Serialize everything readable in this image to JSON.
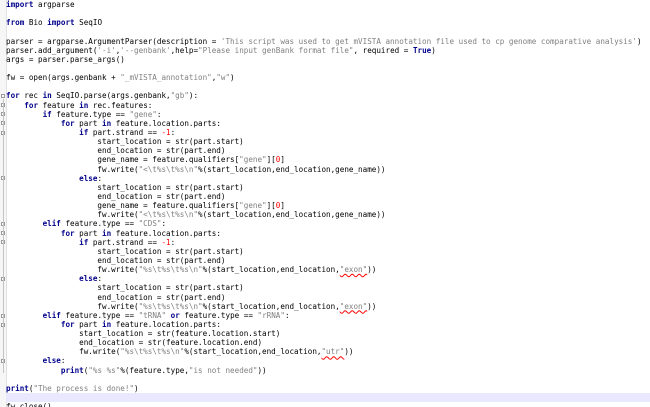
{
  "editor": {
    "language": "python",
    "current_line_index": 43,
    "colors": {
      "background": "#ffffff",
      "keyword": "#00008b",
      "string": "#808080",
      "number": "#ff0000",
      "current_line": "#e8e8ff",
      "gutter": "#f6f6f6"
    },
    "lines": [
      [
        {
          "t": "kw",
          "v": "import"
        },
        {
          "t": "",
          "v": " argparse"
        }
      ],
      [],
      [
        {
          "t": "kw",
          "v": "from"
        },
        {
          "t": "",
          "v": " Bio "
        },
        {
          "t": "kw",
          "v": "import"
        },
        {
          "t": "",
          "v": " SeqIO"
        }
      ],
      [],
      [
        {
          "t": "",
          "v": "parser = argparse.ArgumentParser(description = "
        },
        {
          "t": "str",
          "v": "'This script was used to get mVISTA annotation file used to cp genome comparative analysis'"
        },
        {
          "t": "",
          "v": ")"
        }
      ],
      [
        {
          "t": "",
          "v": "parser.add_argument("
        },
        {
          "t": "str",
          "v": "'-i'"
        },
        {
          "t": "",
          "v": ","
        },
        {
          "t": "str",
          "v": "'--genbank'"
        },
        {
          "t": "",
          "v": ",help="
        },
        {
          "t": "str",
          "v": "\"Please input genBank format file\""
        },
        {
          "t": "",
          "v": ", required = "
        },
        {
          "t": "kw",
          "v": "True"
        },
        {
          "t": "",
          "v": ")"
        }
      ],
      [
        {
          "t": "",
          "v": "args = parser.parse_args()"
        }
      ],
      [],
      [
        {
          "t": "",
          "v": "fw = open(args.genbank + "
        },
        {
          "t": "str",
          "v": "\"_mVISTA_annotation\""
        },
        {
          "t": "",
          "v": ","
        },
        {
          "t": "str",
          "v": "\"w\""
        },
        {
          "t": "",
          "v": ")"
        }
      ],
      [],
      [
        {
          "t": "kw",
          "v": "for"
        },
        {
          "t": "",
          "v": " rec "
        },
        {
          "t": "kw",
          "v": "in"
        },
        {
          "t": "",
          "v": " SeqIO.parse(args.genbank,"
        },
        {
          "t": "str",
          "v": "\"gb\""
        },
        {
          "t": "",
          "v": "):"
        }
      ],
      [
        {
          "t": "",
          "v": "    "
        },
        {
          "t": "kw",
          "v": "for"
        },
        {
          "t": "",
          "v": " feature "
        },
        {
          "t": "kw",
          "v": "in"
        },
        {
          "t": "",
          "v": " rec.features:"
        }
      ],
      [
        {
          "t": "",
          "v": "        "
        },
        {
          "t": "kw",
          "v": "if"
        },
        {
          "t": "",
          "v": " feature.type == "
        },
        {
          "t": "str",
          "v": "\"gene\""
        },
        {
          "t": "",
          "v": ":"
        }
      ],
      [
        {
          "t": "",
          "v": "            "
        },
        {
          "t": "kw",
          "v": "for"
        },
        {
          "t": "",
          "v": " part "
        },
        {
          "t": "kw",
          "v": "in"
        },
        {
          "t": "",
          "v": " feature.location.parts:"
        }
      ],
      [
        {
          "t": "",
          "v": "                "
        },
        {
          "t": "kw",
          "v": "if"
        },
        {
          "t": "",
          "v": " part.strand == "
        },
        {
          "t": "num",
          "v": "-1"
        },
        {
          "t": "",
          "v": ":"
        }
      ],
      [
        {
          "t": "",
          "v": "                    start_location = str(part.start)"
        }
      ],
      [
        {
          "t": "",
          "v": "                    end_location = str(part.end)"
        }
      ],
      [
        {
          "t": "",
          "v": "                    gene_name = feature.qualifiers["
        },
        {
          "t": "str",
          "v": "\"gene\""
        },
        {
          "t": "",
          "v": "]["
        },
        {
          "t": "num",
          "v": "0"
        },
        {
          "t": "",
          "v": "]"
        }
      ],
      [
        {
          "t": "",
          "v": "                    fw.write("
        },
        {
          "t": "str",
          "v": "\"<\\t%s\\t%s\\n\""
        },
        {
          "t": "",
          "v": "%(start_location,end_location,gene_name))"
        }
      ],
      [
        {
          "t": "",
          "v": "                "
        },
        {
          "t": "kw",
          "v": "else"
        },
        {
          "t": "",
          "v": ":"
        }
      ],
      [
        {
          "t": "",
          "v": "                    start_location = str(part.start)"
        }
      ],
      [
        {
          "t": "",
          "v": "                    end_location = str(part.end)"
        }
      ],
      [
        {
          "t": "",
          "v": "                    gene_name = feature.qualifiers["
        },
        {
          "t": "str",
          "v": "\"gene\""
        },
        {
          "t": "",
          "v": "]["
        },
        {
          "t": "num",
          "v": "0"
        },
        {
          "t": "",
          "v": "]"
        }
      ],
      [
        {
          "t": "",
          "v": "                    fw.write("
        },
        {
          "t": "str",
          "v": "\"<\\t%s\\t%s\\n\""
        },
        {
          "t": "",
          "v": "%(start_location,end_location,gene_name))"
        }
      ],
      [
        {
          "t": "",
          "v": "        "
        },
        {
          "t": "kw",
          "v": "elif"
        },
        {
          "t": "",
          "v": " feature.type == "
        },
        {
          "t": "str",
          "v": "\"CDS\""
        },
        {
          "t": "",
          "v": ":"
        }
      ],
      [
        {
          "t": "",
          "v": "            "
        },
        {
          "t": "kw",
          "v": "for"
        },
        {
          "t": "",
          "v": " part "
        },
        {
          "t": "kw",
          "v": "in"
        },
        {
          "t": "",
          "v": " feature.location.parts:"
        }
      ],
      [
        {
          "t": "",
          "v": "                "
        },
        {
          "t": "kw",
          "v": "if"
        },
        {
          "t": "",
          "v": " part.strand == "
        },
        {
          "t": "num",
          "v": "-1"
        },
        {
          "t": "",
          "v": ":"
        }
      ],
      [
        {
          "t": "",
          "v": "                    start_location = str(part.start)"
        }
      ],
      [
        {
          "t": "",
          "v": "                    end_location = str(part.end)"
        }
      ],
      [
        {
          "t": "",
          "v": "                    fw.write("
        },
        {
          "t": "str",
          "v": "\"%s\\t%s\\t%s\\n\""
        },
        {
          "t": "",
          "v": "%(start_location,end_location,"
        },
        {
          "t": "str err",
          "v": "\"exon\""
        },
        {
          "t": "",
          "v": "))"
        }
      ],
      [
        {
          "t": "",
          "v": "                "
        },
        {
          "t": "kw",
          "v": "else"
        },
        {
          "t": "",
          "v": ":"
        }
      ],
      [
        {
          "t": "",
          "v": "                    start_location = str(part.start)"
        }
      ],
      [
        {
          "t": "",
          "v": "                    end_location = str(part.end)"
        }
      ],
      [
        {
          "t": "",
          "v": "                    fw.write("
        },
        {
          "t": "str",
          "v": "\"%s\\t%s\\t%s\\n\""
        },
        {
          "t": "",
          "v": "%(start_location,end_location,"
        },
        {
          "t": "str err",
          "v": "\"exon\""
        },
        {
          "t": "",
          "v": "))"
        }
      ],
      [
        {
          "t": "",
          "v": "        "
        },
        {
          "t": "kw",
          "v": "elif"
        },
        {
          "t": "",
          "v": " feature.type == "
        },
        {
          "t": "str",
          "v": "\"tRNA\""
        },
        {
          "t": "",
          "v": " "
        },
        {
          "t": "kw",
          "v": "or"
        },
        {
          "t": "",
          "v": " feature.type == "
        },
        {
          "t": "str",
          "v": "\"rRNA\""
        },
        {
          "t": "",
          "v": ":"
        }
      ],
      [
        {
          "t": "",
          "v": "            "
        },
        {
          "t": "kw",
          "v": "for"
        },
        {
          "t": "",
          "v": " part "
        },
        {
          "t": "kw",
          "v": "in"
        },
        {
          "t": "",
          "v": " feature.location.parts:"
        }
      ],
      [
        {
          "t": "",
          "v": "                start_location = str(feature.location.start)"
        }
      ],
      [
        {
          "t": "",
          "v": "                end_location = str(feature.location.end)"
        }
      ],
      [
        {
          "t": "",
          "v": "                fw.write("
        },
        {
          "t": "str",
          "v": "\"%s\\t%s\\t%s\\n\""
        },
        {
          "t": "",
          "v": "%(start_location,end_location,"
        },
        {
          "t": "str err",
          "v": "\"utr\""
        },
        {
          "t": "",
          "v": "))"
        }
      ],
      [
        {
          "t": "",
          "v": "        "
        },
        {
          "t": "kw",
          "v": "else"
        },
        {
          "t": "",
          "v": ":"
        }
      ],
      [
        {
          "t": "",
          "v": "            "
        },
        {
          "t": "kw",
          "v": "print"
        },
        {
          "t": "",
          "v": "("
        },
        {
          "t": "str",
          "v": "\"%s %s\""
        },
        {
          "t": "",
          "v": "%(feature.type,"
        },
        {
          "t": "str",
          "v": "\"is not needed\""
        },
        {
          "t": "",
          "v": "))"
        }
      ],
      [],
      [
        {
          "t": "kw",
          "v": "print"
        },
        {
          "t": "",
          "v": "("
        },
        {
          "t": "str",
          "v": "\"The process is done!\""
        },
        {
          "t": "",
          "v": ")"
        }
      ],
      [],
      [
        {
          "t": "",
          "v": "fw.close()"
        }
      ]
    ]
  }
}
